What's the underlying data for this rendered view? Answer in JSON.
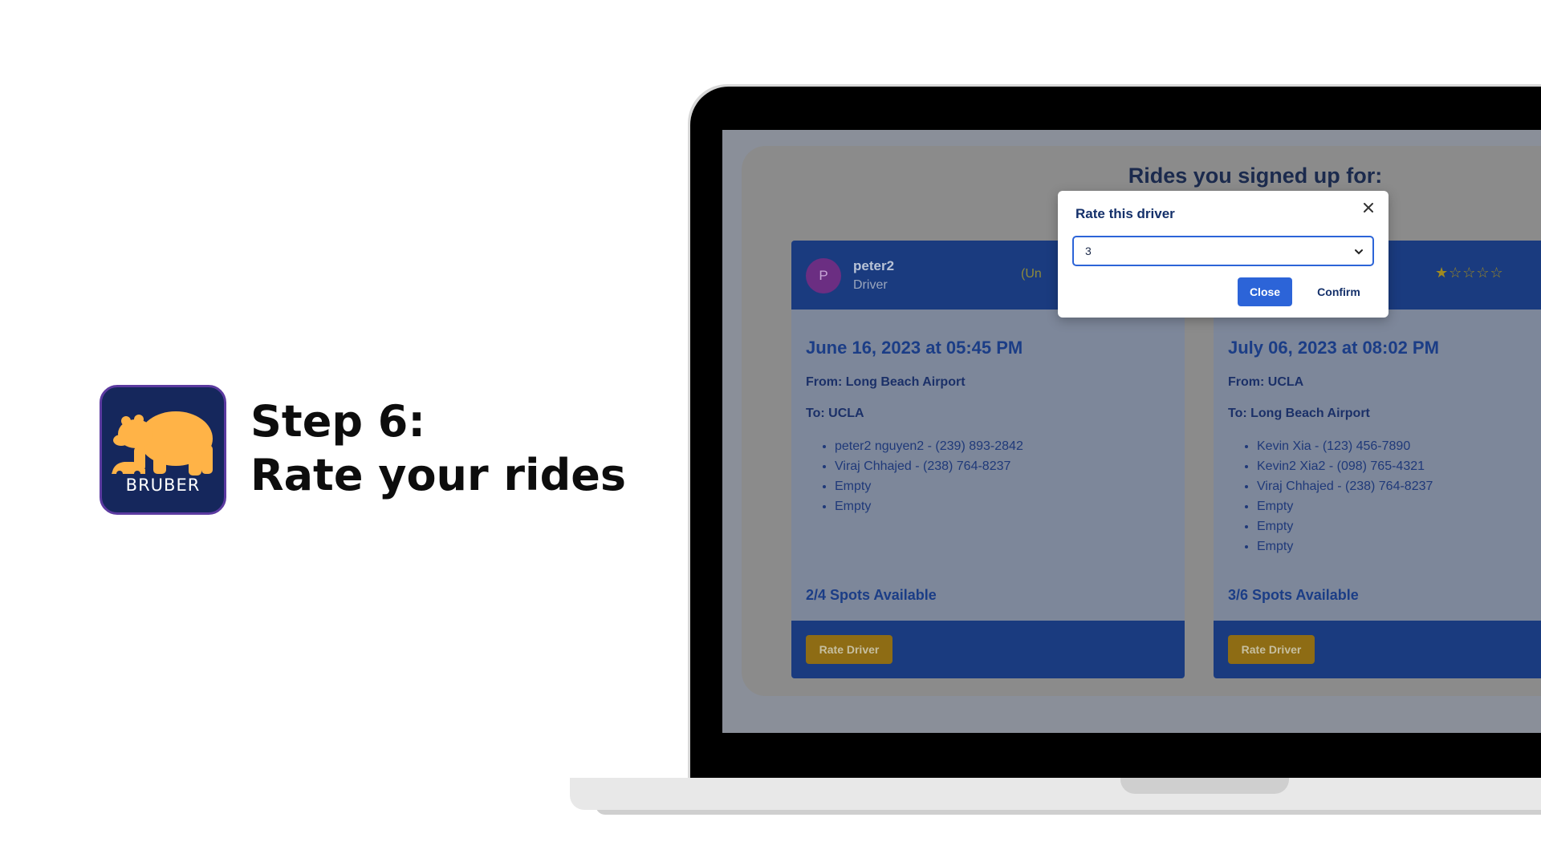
{
  "hero": {
    "brand": "BRUBER",
    "step": "Step 6:",
    "subtitle": "Rate your rides"
  },
  "page": {
    "heading": "Rides you signed up for:"
  },
  "modal": {
    "title": "Rate this driver",
    "selected_value": "3",
    "close_label": "Close",
    "confirm_label": "Confirm"
  },
  "rides": [
    {
      "avatar_initial": "P",
      "driver_name": "peter2",
      "driver_role": "Driver",
      "rating_fragment": "(Un",
      "date": "June 16, 2023 at 05:45 PM",
      "from": "From: Long Beach Airport",
      "to": "To: UCLA",
      "riders": [
        "peter2 nguyen2 - (239) 893-2842",
        "Viraj Chhajed - (238) 764-8237",
        "Empty",
        "Empty"
      ],
      "spots": "2/4 Spots Available",
      "button": "Rate Driver"
    },
    {
      "stars": "★☆☆☆☆",
      "date": "July 06, 2023 at 08:02 PM",
      "from": "From: UCLA",
      "to": "To: Long Beach Airport",
      "riders": [
        "Kevin Xia - (123) 456-7890",
        "Kevin2 Xia2 - (098) 765-4321",
        "Viraj Chhajed - (238) 764-8237",
        "Empty",
        "Empty",
        "Empty"
      ],
      "spots": "3/6 Spots Available",
      "button": "Rate Driver"
    }
  ],
  "colors": {
    "primary": "#1a3b7f",
    "accent_button": "#2c64d8",
    "rate_button": "#8e6c14",
    "icon_bg": "#15275c",
    "bear": "#ffb347"
  }
}
